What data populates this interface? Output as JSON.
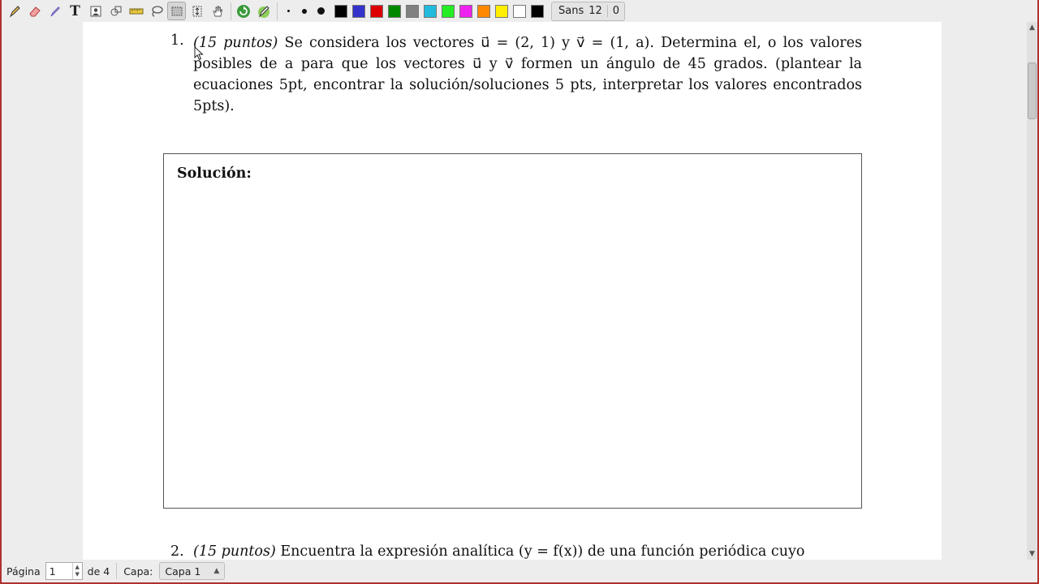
{
  "toolbar": {
    "font_name": "Sans",
    "font_size": "12",
    "extra_value": "0",
    "colors": [
      "#000000",
      "#3333cc",
      "#dd0000",
      "#008800",
      "#808080",
      "#22bbdd",
      "#22ee22",
      "#ee22ee",
      "#ff8800",
      "#ffee00",
      "#ffffff",
      "#000000"
    ]
  },
  "document": {
    "problem1": {
      "number": "1.",
      "points": "(15 puntos)",
      "text": " Se considera los vectores u⃗ = (2, 1) y v⃗ = (1, a). Determina el, o los valores posibles de a para que los vectores u⃗ y v⃗ formen un ángulo de 45 grados. (plantear la ecuaciones 5pt, encontrar la solución/soluciones 5 pts, interpretar los valores encontrados 5pts)."
    },
    "solution_label": "Solución:",
    "problem2": {
      "number": "2.",
      "points": "(15 puntos)",
      "text": " Encuentra la expresión analítica (y = f(x)) de una función periódica cuyo"
    }
  },
  "statusbar": {
    "page_label": "Página",
    "page_value": "1",
    "of_pages": "de 4",
    "layer_label": "Capa:",
    "layer_value": "Capa 1"
  }
}
